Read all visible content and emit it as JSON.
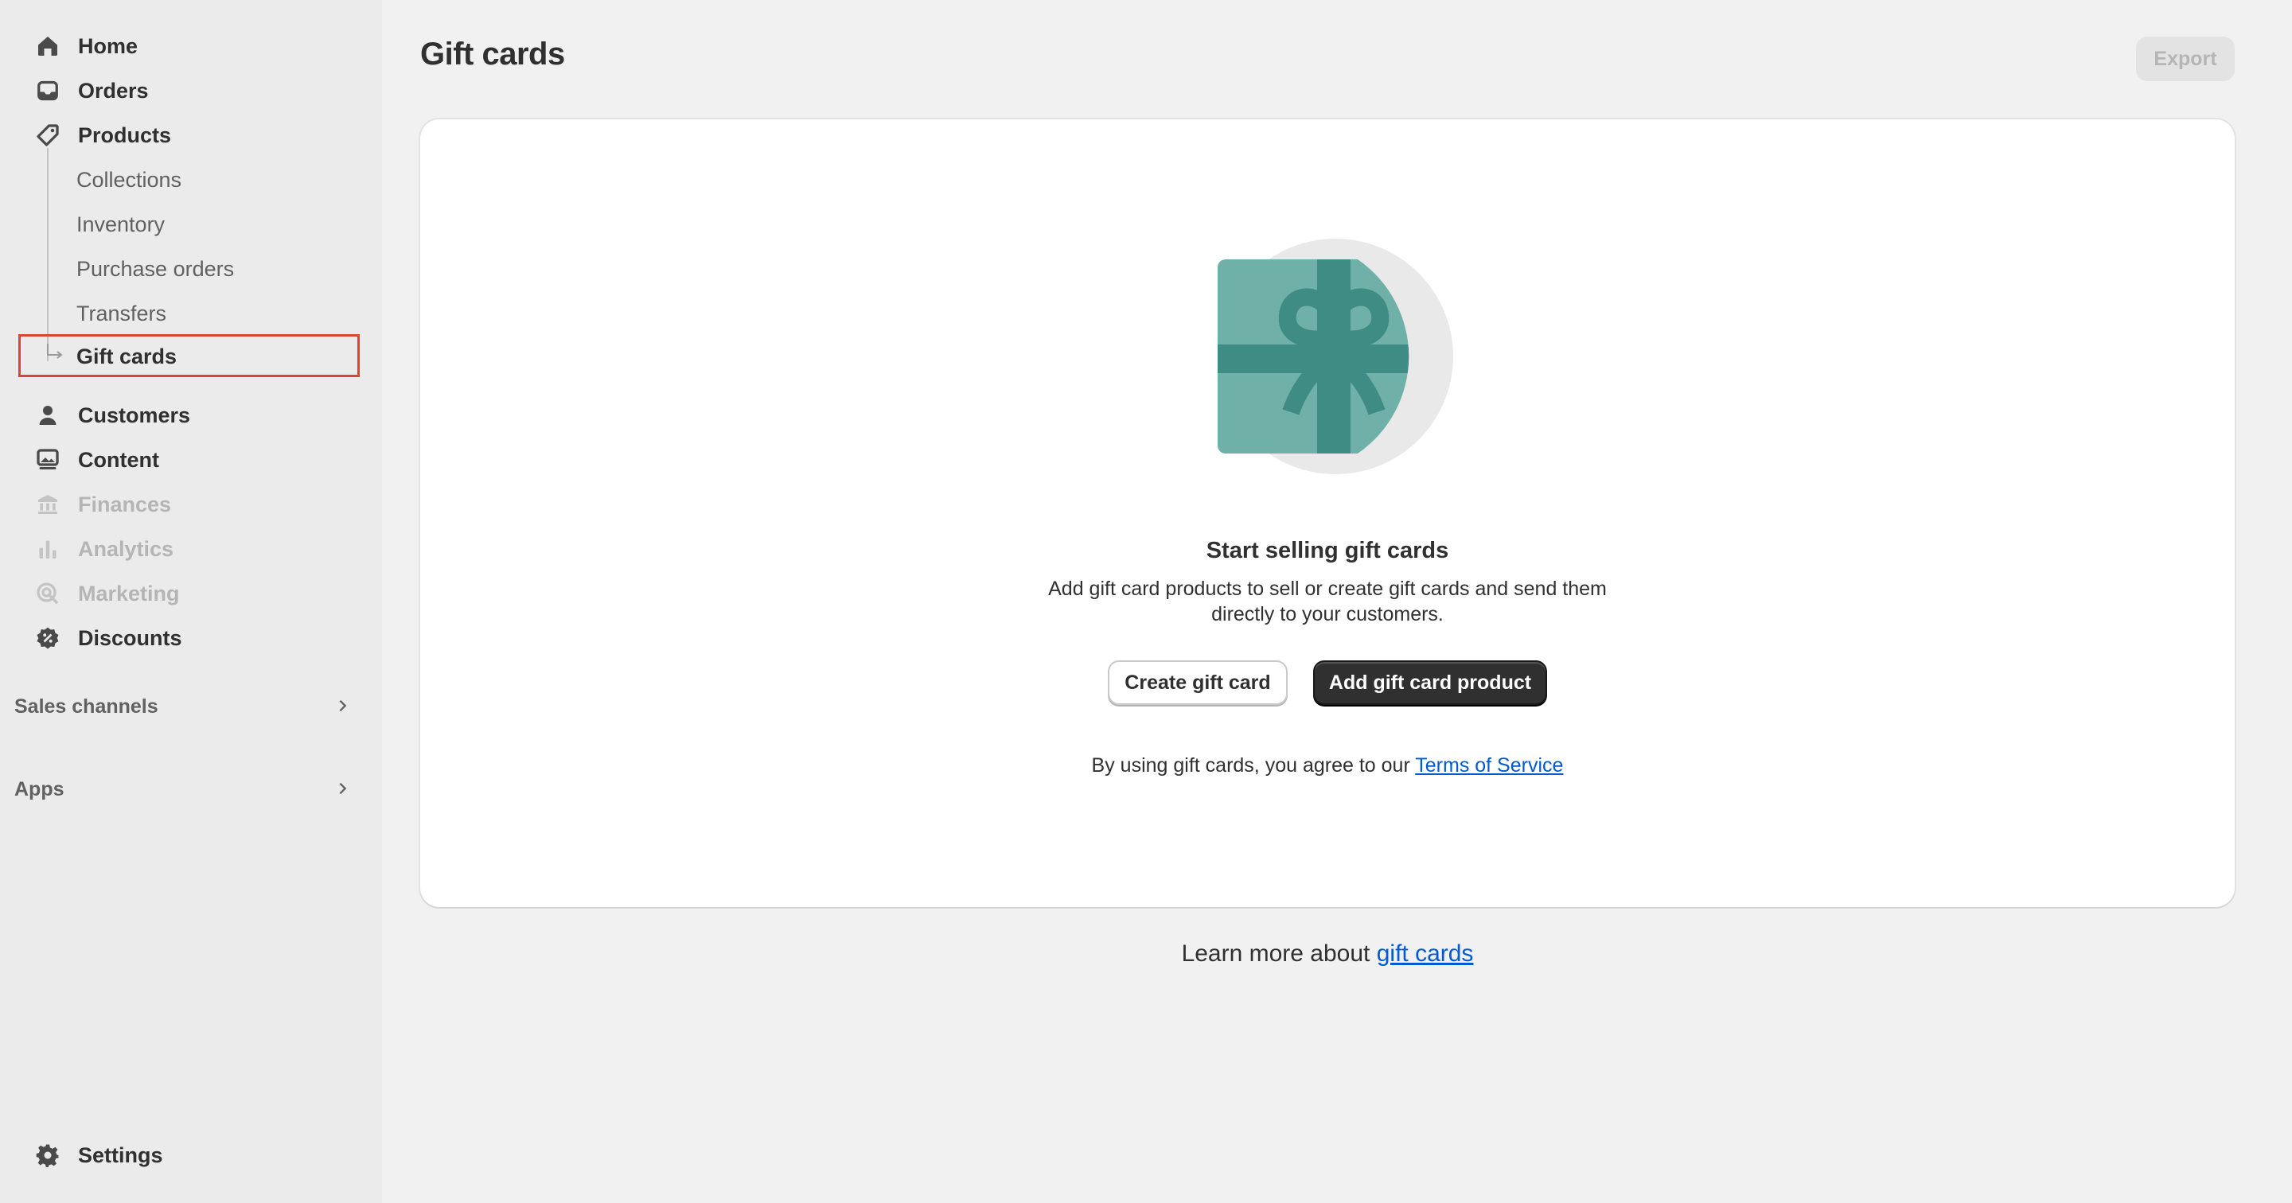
{
  "sidebar": {
    "items": [
      {
        "label": "Home",
        "icon": "home-icon"
      },
      {
        "label": "Orders",
        "icon": "inbox-icon"
      },
      {
        "label": "Products",
        "icon": "tag-icon"
      },
      {
        "label": "Customers",
        "icon": "person-icon"
      },
      {
        "label": "Content",
        "icon": "image-icon"
      },
      {
        "label": "Finances",
        "icon": "bank-icon",
        "disabled": true
      },
      {
        "label": "Analytics",
        "icon": "bar-chart-icon",
        "disabled": true
      },
      {
        "label": "Marketing",
        "icon": "target-icon",
        "disabled": true
      },
      {
        "label": "Discounts",
        "icon": "discount-icon"
      }
    ],
    "products_sub": [
      {
        "label": "Collections"
      },
      {
        "label": "Inventory"
      },
      {
        "label": "Purchase orders"
      },
      {
        "label": "Transfers"
      },
      {
        "label": "Gift cards",
        "active": true
      }
    ],
    "sales_channels": "Sales channels",
    "apps": "Apps",
    "settings": "Settings"
  },
  "header": {
    "title": "Gift cards",
    "export_label": "Export"
  },
  "empty_state": {
    "title": "Start selling gift cards",
    "description": "Add gift card products to sell or create gift cards and send them directly to your customers.",
    "secondary_button": "Create gift card",
    "primary_button": "Add gift card product",
    "terms_prefix": "By using gift cards, you agree to our ",
    "terms_link": "Terms of Service"
  },
  "footer": {
    "learn_prefix": "Learn more about ",
    "learn_link": "gift cards"
  },
  "colors": {
    "accent_teal": "#6fb0a9",
    "accent_teal_dark": "#3f8c84",
    "active_outline": "#e0432f",
    "link": "#005bd3"
  }
}
